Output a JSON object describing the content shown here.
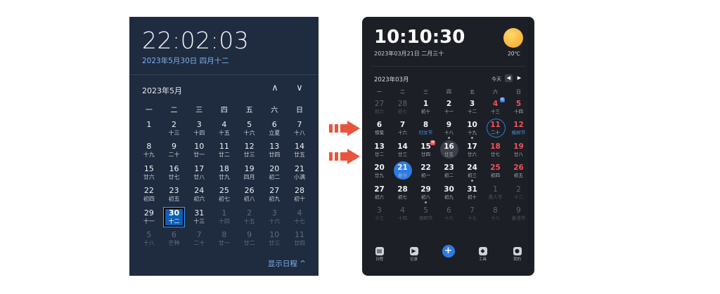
{
  "left": {
    "clock": "22:02:03",
    "date": "2023年5月30日 四月十二",
    "month": "2023年5月",
    "weekdays": [
      "一",
      "二",
      "三",
      "四",
      "五",
      "六",
      "日"
    ],
    "rows": [
      [
        {
          "n": "1",
          "s": "",
          "d": false
        },
        {
          "n": "2",
          "s": "十三",
          "d": false
        },
        {
          "n": "3",
          "s": "十四",
          "d": false
        },
        {
          "n": "4",
          "s": "十五",
          "d": false
        },
        {
          "n": "5",
          "s": "十六",
          "d": false
        },
        {
          "n": "6",
          "s": "立夏",
          "d": false
        },
        {
          "n": "7",
          "s": "十八",
          "d": false
        }
      ],
      [
        {
          "n": "8",
          "s": "十九",
          "d": false
        },
        {
          "n": "9",
          "s": "二十",
          "d": false
        },
        {
          "n": "10",
          "s": "廿一",
          "d": false
        },
        {
          "n": "11",
          "s": "廿二",
          "d": false
        },
        {
          "n": "12",
          "s": "廿三",
          "d": false
        },
        {
          "n": "13",
          "s": "廿四",
          "d": false
        },
        {
          "n": "14",
          "s": "廿五",
          "d": false
        }
      ],
      [
        {
          "n": "15",
          "s": "廿六",
          "d": false
        },
        {
          "n": "16",
          "s": "廿七",
          "d": false
        },
        {
          "n": "17",
          "s": "廿八",
          "d": false
        },
        {
          "n": "18",
          "s": "廿九",
          "d": false
        },
        {
          "n": "19",
          "s": "四月",
          "d": false
        },
        {
          "n": "20",
          "s": "初二",
          "d": false
        },
        {
          "n": "21",
          "s": "小满",
          "d": false
        }
      ],
      [
        {
          "n": "22",
          "s": "初四",
          "d": false
        },
        {
          "n": "23",
          "s": "初五",
          "d": false
        },
        {
          "n": "24",
          "s": "初六",
          "d": false
        },
        {
          "n": "25",
          "s": "初七",
          "d": false
        },
        {
          "n": "26",
          "s": "初八",
          "d": false
        },
        {
          "n": "27",
          "s": "初九",
          "d": false
        },
        {
          "n": "28",
          "s": "初十",
          "d": false
        }
      ],
      [
        {
          "n": "29",
          "s": "十一",
          "d": false
        },
        {
          "n": "30",
          "s": "十二",
          "d": false,
          "sel": true
        },
        {
          "n": "31",
          "s": "十三",
          "d": false
        },
        {
          "n": "1",
          "s": "十四",
          "d": true
        },
        {
          "n": "2",
          "s": "十五",
          "d": true
        },
        {
          "n": "3",
          "s": "十六",
          "d": true
        },
        {
          "n": "4",
          "s": "十七",
          "d": true
        }
      ],
      [
        {
          "n": "5",
          "s": "十八",
          "d": true
        },
        {
          "n": "6",
          "s": "芒种",
          "d": true
        },
        {
          "n": "7",
          "s": "二十",
          "d": true
        },
        {
          "n": "8",
          "s": "廿一",
          "d": true
        },
        {
          "n": "9",
          "s": "廿二",
          "d": true
        },
        {
          "n": "10",
          "s": "廿三",
          "d": true
        },
        {
          "n": "11",
          "s": "廿四",
          "d": true
        }
      ]
    ],
    "schedule_label": "显示日程 ^"
  },
  "right": {
    "clock": "10:10:30",
    "date": "2023年03月21日 二月三十",
    "temp": "20℃",
    "month": "2023年03月",
    "today_label": "今天",
    "weekdays": [
      "一",
      "二",
      "三",
      "四",
      "五",
      "六",
      "日"
    ],
    "rows": [
      [
        {
          "n": "27",
          "s": "初六",
          "t": "dim"
        },
        {
          "n": "28",
          "s": "初七",
          "t": "dim"
        },
        {
          "n": "1",
          "s": "初十",
          "t": ""
        },
        {
          "n": "2",
          "s": "十一",
          "t": ""
        },
        {
          "n": "3",
          "s": "十二",
          "t": ""
        },
        {
          "n": "4",
          "s": "十三",
          "t": "red",
          "tag": "班"
        },
        {
          "n": "5",
          "s": "十四",
          "t": "red"
        }
      ],
      [
        {
          "n": "6",
          "s": "惊蛰",
          "t": ""
        },
        {
          "n": "7",
          "s": "十六",
          "t": ""
        },
        {
          "n": "8",
          "s": "妇女节",
          "t": "blue"
        },
        {
          "n": "9",
          "s": "十八",
          "t": "",
          "dot": true
        },
        {
          "n": "10",
          "s": "十九",
          "t": "",
          "dot": true
        },
        {
          "n": "11",
          "s": "二十",
          "t": "red",
          "ring": true
        },
        {
          "n": "12",
          "s": "植树节",
          "t": "red blue"
        }
      ],
      [
        {
          "n": "13",
          "s": "廿二",
          "t": ""
        },
        {
          "n": "14",
          "s": "廿三",
          "t": ""
        },
        {
          "n": "15",
          "s": "廿四",
          "t": "",
          "tag": "休"
        },
        {
          "n": "16",
          "s": "廿五",
          "t": "",
          "grey": true
        },
        {
          "n": "17",
          "s": "廿六",
          "t": ""
        },
        {
          "n": "18",
          "s": "廿七",
          "t": "red"
        },
        {
          "n": "19",
          "s": "廿八",
          "t": "red"
        }
      ],
      [
        {
          "n": "20",
          "s": "廿九",
          "t": ""
        },
        {
          "n": "21",
          "s": "春分",
          "t": "",
          "fill": true
        },
        {
          "n": "22",
          "s": "初一",
          "t": ""
        },
        {
          "n": "23",
          "s": "初二",
          "t": ""
        },
        {
          "n": "24",
          "s": "初三",
          "t": "",
          "dot": true
        },
        {
          "n": "25",
          "s": "初四",
          "t": "red"
        },
        {
          "n": "26",
          "s": "初五",
          "t": "red"
        }
      ],
      [
        {
          "n": "27",
          "s": "初六",
          "t": ""
        },
        {
          "n": "28",
          "s": "初七",
          "t": ""
        },
        {
          "n": "29",
          "s": "初八",
          "t": "",
          "dot": true
        },
        {
          "n": "30",
          "s": "初九",
          "t": ""
        },
        {
          "n": "31",
          "s": "初十",
          "t": ""
        },
        {
          "n": "1",
          "s": "愚人节",
          "t": "dim"
        },
        {
          "n": "2",
          "s": "十二",
          "t": "dim"
        }
      ],
      [
        {
          "n": "3",
          "s": "十三",
          "t": "dim"
        },
        {
          "n": "4",
          "s": "十四",
          "t": "dim"
        },
        {
          "n": "5",
          "s": "清明节",
          "t": "dim"
        },
        {
          "n": "6",
          "s": "十六",
          "t": "dim"
        },
        {
          "n": "7",
          "s": "十七",
          "t": "dim"
        },
        {
          "n": "8",
          "s": "十八",
          "t": "dim"
        },
        {
          "n": "9",
          "s": "复活节",
          "t": "dim"
        }
      ]
    ],
    "bottom_bar": [
      {
        "label": "日程",
        "icon": "clipboard-icon"
      },
      {
        "label": "记录",
        "icon": "play-icon"
      },
      {
        "label": "",
        "icon": "plus-icon"
      },
      {
        "label": "工具",
        "icon": "cube-icon"
      },
      {
        "label": "我的",
        "icon": "user-icon"
      }
    ]
  },
  "colors": {
    "left_bg": "#1f2b3e",
    "right_bg": "#1c1f26",
    "accent": "#2e7be6",
    "holiday_red": "#f2525c",
    "arrow": "#e8553e"
  }
}
